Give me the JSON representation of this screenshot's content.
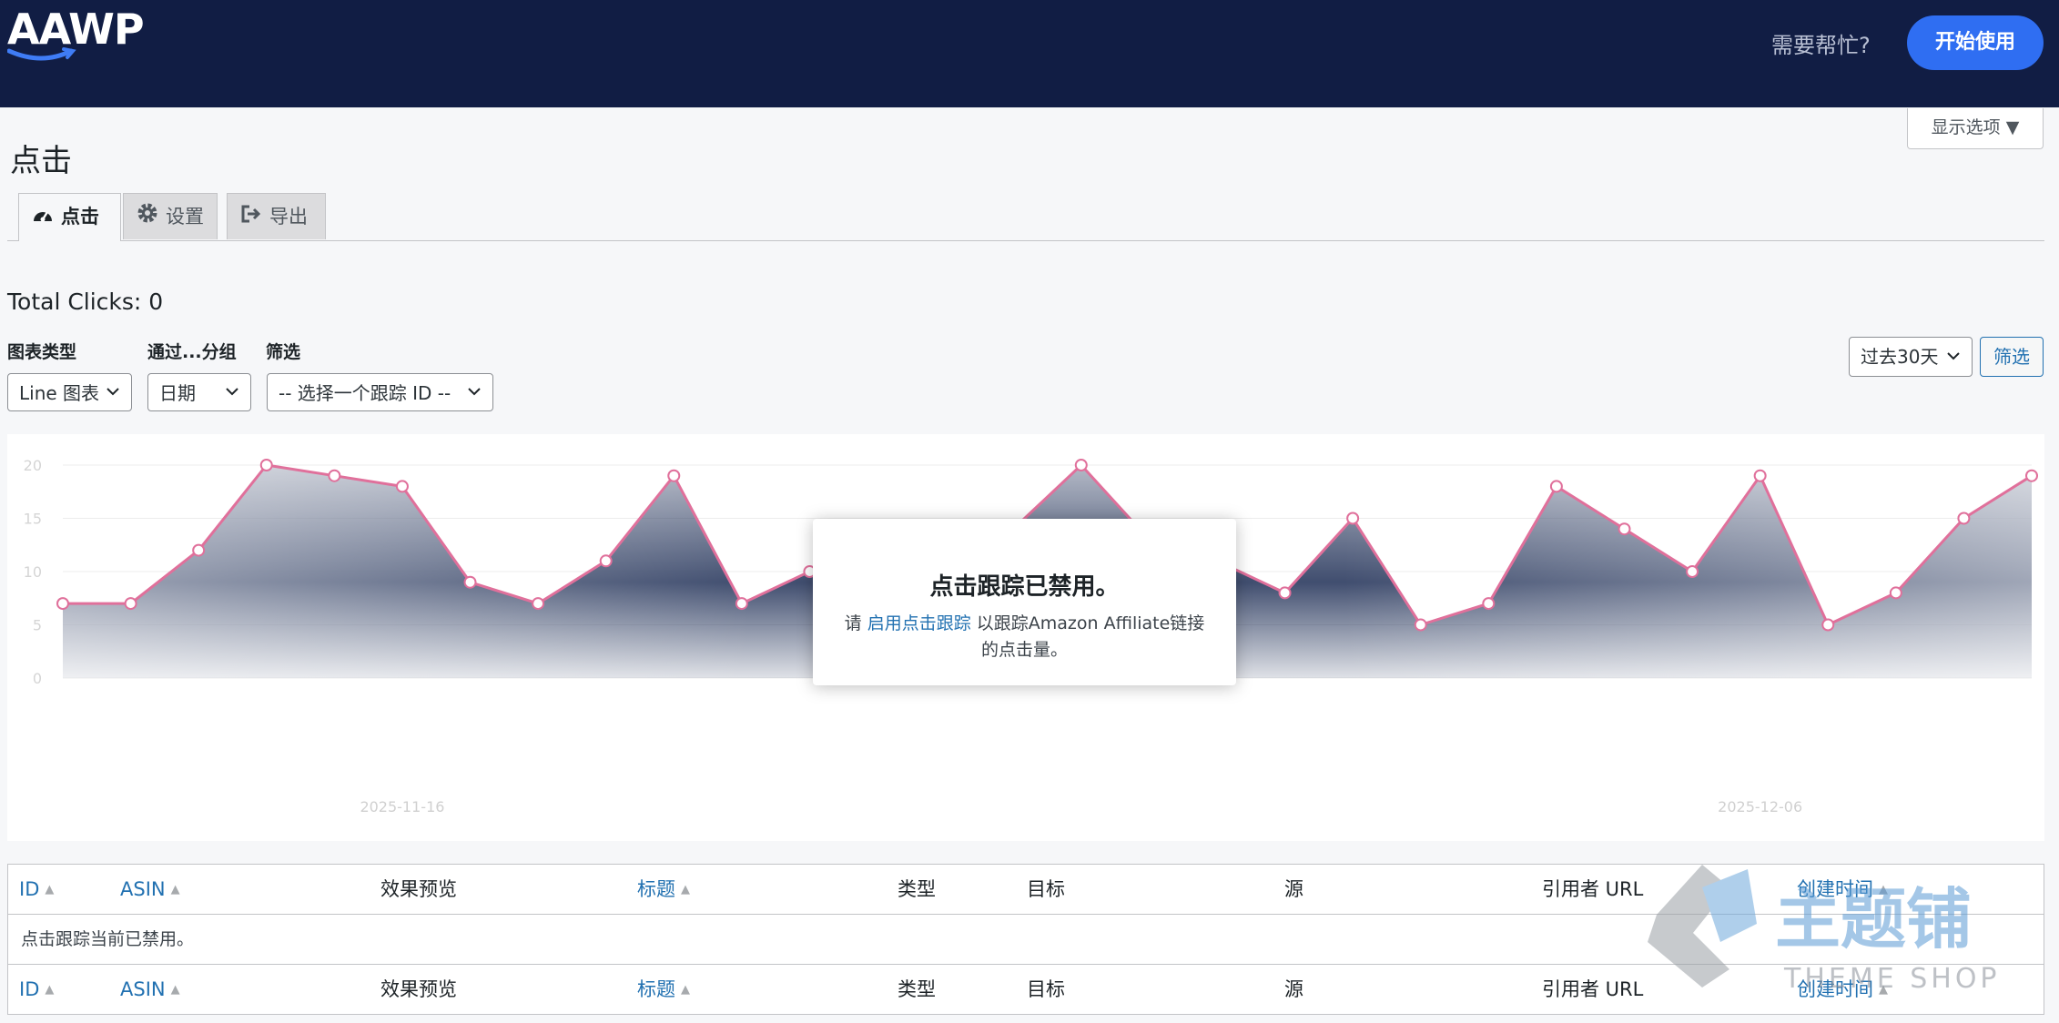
{
  "header": {
    "logo_text": "AAWP",
    "help_text": "需要帮忙?",
    "start_button": "开始使用",
    "colors": {
      "bar": "#111d44",
      "button": "#2f6ef2"
    }
  },
  "screen_options": {
    "label": "显示选项 ▼"
  },
  "page": {
    "title": "点击"
  },
  "tabs": [
    {
      "label": "点击",
      "icon": "dashboard-icon",
      "active": true
    },
    {
      "label": "设置",
      "icon": "gear-icon",
      "active": false
    },
    {
      "label": "导出",
      "icon": "export-icon",
      "active": false
    }
  ],
  "stats": {
    "total_clicks": "Total Clicks: 0"
  },
  "filters": {
    "chart_type": {
      "label": "图表类型",
      "value": "Line 图表"
    },
    "group_by": {
      "label": "通过...分组",
      "value": "日期"
    },
    "filter": {
      "label": "筛选",
      "value": "-- 选择一个跟踪 ID --"
    },
    "range": {
      "value": "过去30天"
    },
    "filter_button": "筛选"
  },
  "chart_data": {
    "type": "area",
    "x_ticks": [
      "2025-11-16",
      "2025-12-06"
    ],
    "y_ticks": [
      "0",
      "5",
      "10",
      "15",
      "20"
    ],
    "ylim": [
      0,
      20
    ],
    "grid": true,
    "values": [
      7,
      7,
      12,
      20,
      19,
      18,
      9,
      7,
      11,
      19,
      7,
      10,
      12,
      6,
      14,
      20,
      13,
      11,
      8,
      15,
      5,
      7,
      18,
      14,
      10,
      19,
      5,
      8,
      15,
      19
    ],
    "line_color": "#e0709b",
    "fill_color": "#2b3a5f"
  },
  "modal": {
    "title": "点击跟踪已禁用。",
    "text_before": "请 ",
    "link": "启用点击跟踪",
    "text_after": " 以跟踪Amazon Affiliate链接的点击量。"
  },
  "table": {
    "columns": [
      "ID",
      "ASIN",
      "效果预览",
      "标题",
      "类型",
      "目标",
      "源",
      "引用者 URL",
      "创建时间"
    ],
    "empty_message": "点击跟踪当前已禁用。"
  },
  "watermark": {
    "text_cn": "主题铺",
    "text_en": "THEME SHOP"
  }
}
